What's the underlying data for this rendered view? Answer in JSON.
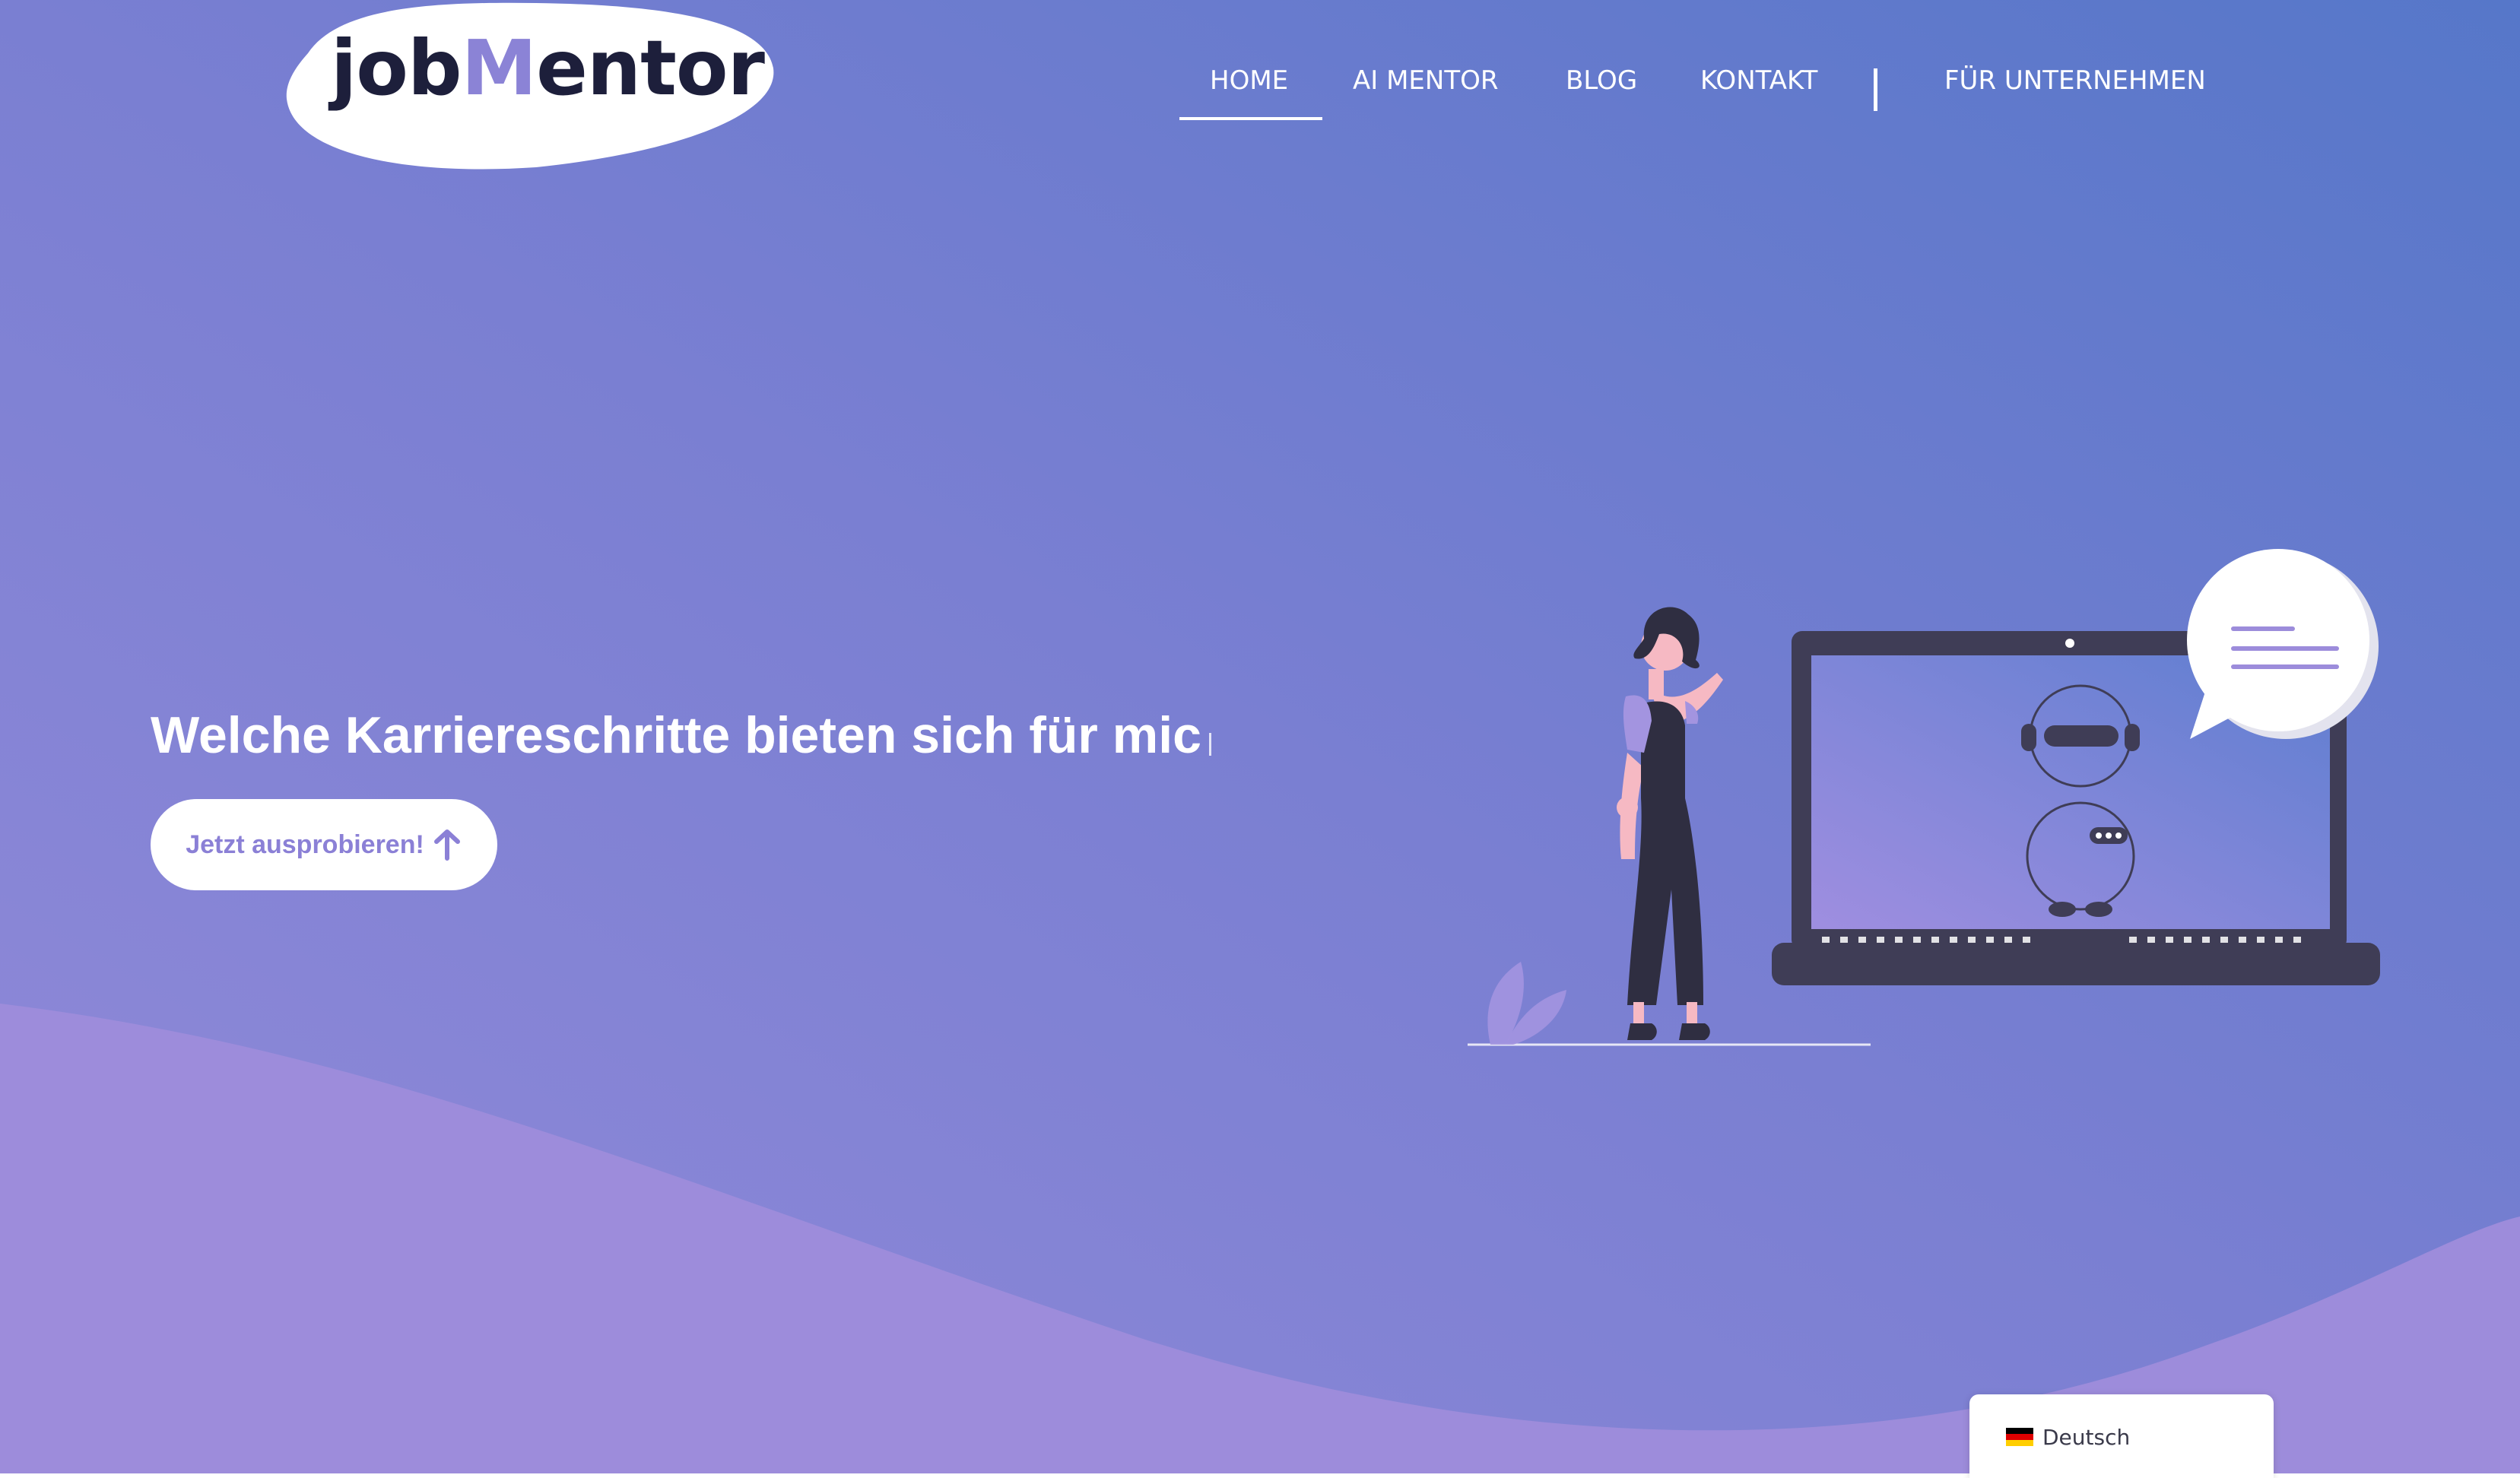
{
  "logo": {
    "text_prefix": "job",
    "text_accent": "M",
    "text_suffix": "entor"
  },
  "nav": {
    "items": [
      {
        "label": "HOME",
        "active": true
      },
      {
        "label": "AI MENTOR"
      },
      {
        "label": "BLOG"
      },
      {
        "label": "KONTAKT"
      }
    ],
    "business_link": "FÜR UNTERNEHMEN"
  },
  "hero": {
    "headline": "Welche Karriereschritte bieten sich für mic",
    "cta_label": "Jetzt ausprobieren!",
    "cta_icon": "arrow-up-icon"
  },
  "language_switcher": {
    "label": "Deutsch",
    "flag": "de-flag-icon"
  },
  "colors": {
    "gradient_start": "#8b86d6",
    "gradient_end": "#5878cb",
    "wave": "#9c8cda",
    "accent": "#8b80d6",
    "dark": "#3f3d56"
  }
}
